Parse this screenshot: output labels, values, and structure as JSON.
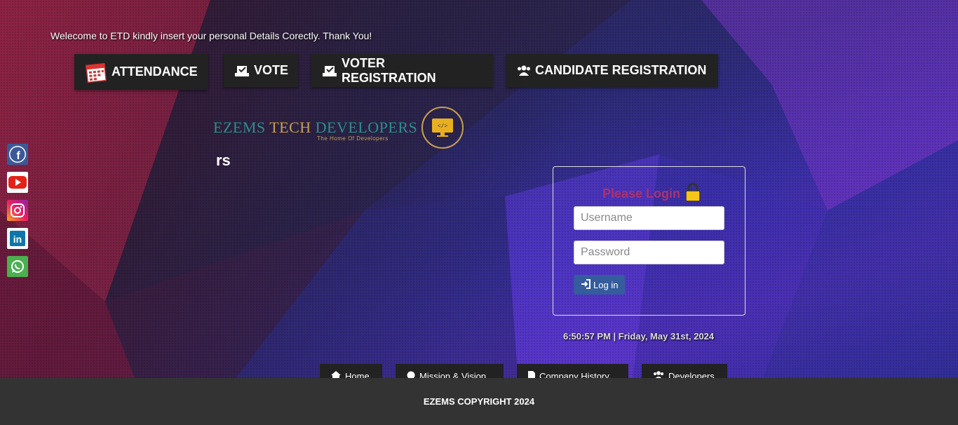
{
  "welcome": "Welecome to ETD kindly insert your personal Details Corectly. Thank You!",
  "nav": {
    "attendance": "ATTENDANCE",
    "vote": "VOTE",
    "voter_registration": "VOTER REGISTRATION",
    "candidate_registration": "CANDIDATE REGISTRATION"
  },
  "logo": {
    "part1": "EZEMS ",
    "part2": "TECH ",
    "part3": "DEVELOPERS",
    "tagline": "The Home Of Developers"
  },
  "fragment_text": "rs",
  "social": [
    "facebook-icon",
    "youtube-icon",
    "instagram-icon",
    "linkedin-icon",
    "whatsapp-icon"
  ],
  "login": {
    "title": "Please Login",
    "username_placeholder": "Username",
    "password_placeholder": "Password",
    "button": "Log in"
  },
  "clock": "6:50:57 PM | Friday, May 31st, 2024",
  "bottom_nav": {
    "home": "Home",
    "mission": "Mission & Vision",
    "history": "Company History",
    "developers": "Developers"
  },
  "footer": "EZEMS COPYRIGHT 2024",
  "colors": {
    "accent_login_title": "#b0306a",
    "login_button": "#355c9c",
    "nav_button_bg": "#222222",
    "footer_bg": "#333333",
    "logo_teal": "#2b8f8a",
    "logo_gold": "#c8a050"
  }
}
